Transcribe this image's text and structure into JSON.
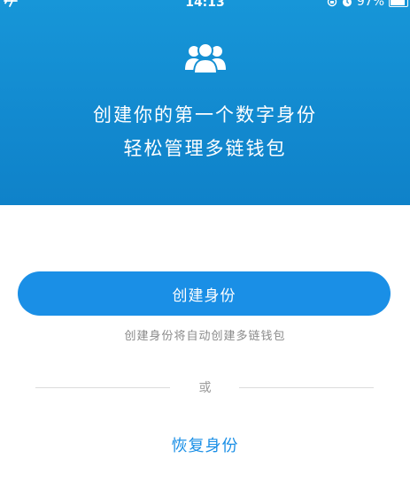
{
  "status_bar": {
    "time": "14:13",
    "battery_percent": "97%",
    "battery_level": 0.97
  },
  "header": {
    "icon": "people-group-icon",
    "headline_line1": "创建你的第一个数字身份",
    "headline_line2": "轻松管理多链钱包"
  },
  "main": {
    "create_button_label": "创建身份",
    "create_hint": "创建身份将自动创建多链钱包",
    "divider_text": "或",
    "restore_link_label": "恢复身份"
  },
  "colors": {
    "header_gradient_top": "#1796d8",
    "header_gradient_bottom": "#0f82c9",
    "primary": "#1a8fe6",
    "hint_text": "#8a8a8a",
    "divider": "#dcdcdc"
  }
}
